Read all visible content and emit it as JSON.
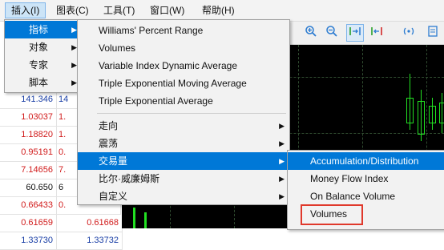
{
  "menubar": {
    "items": [
      {
        "label": "插入(I)"
      },
      {
        "label": "图表(C)"
      },
      {
        "label": "工具(T)"
      },
      {
        "label": "窗口(W)"
      },
      {
        "label": "帮助(H)"
      }
    ]
  },
  "left_edge_label": "I",
  "insert_menu": {
    "items": [
      {
        "label": "指标"
      },
      {
        "label": "对象"
      },
      {
        "label": "专家"
      },
      {
        "label": "脚本"
      }
    ]
  },
  "indicators_menu": {
    "items": [
      {
        "label": "Williams' Percent Range"
      },
      {
        "label": "Volumes"
      },
      {
        "label": "Variable Index Dynamic Average"
      },
      {
        "label": "Triple Exponential Moving Average"
      },
      {
        "label": "Triple Exponential Average"
      },
      {
        "label": "走向"
      },
      {
        "label": "震荡"
      },
      {
        "label": "交易量"
      },
      {
        "label": "比尔·威廉姆斯"
      },
      {
        "label": "自定义"
      }
    ]
  },
  "volume_menu": {
    "items": [
      {
        "label": "Accumulation/Distribution"
      },
      {
        "label": "Money Flow Index"
      },
      {
        "label": "On Balance Volume"
      },
      {
        "label": "Volumes"
      }
    ]
  },
  "market_watch": {
    "rows": [
      {
        "bid": "141.346",
        "ask": "14"
      },
      {
        "bid": "1.03037",
        "ask": "1."
      },
      {
        "bid": "1.18820",
        "ask": "1."
      },
      {
        "bid": "0.95191",
        "ask": "0."
      },
      {
        "bid": "7.14656",
        "ask": "7."
      },
      {
        "bid": "60.650",
        "ask": "6"
      },
      {
        "bid": "0.66433",
        "ask": "0."
      },
      {
        "bid": "0.61659",
        "ask": "0.61668"
      },
      {
        "bid": "1.33730",
        "ask": "1.33732"
      }
    ]
  },
  "toolbar": {
    "icons": [
      "zoom-in-icon",
      "zoom-out-icon",
      "chart-shift-icon",
      "autoscroll-icon",
      "signal-icon",
      "template-icon"
    ]
  },
  "colors": {
    "menu_highlight": "#0078d7",
    "candle": "#22e022",
    "chart_background": "#000000",
    "price_down": "#d11b1b",
    "highlight_box": "#e0392c"
  }
}
